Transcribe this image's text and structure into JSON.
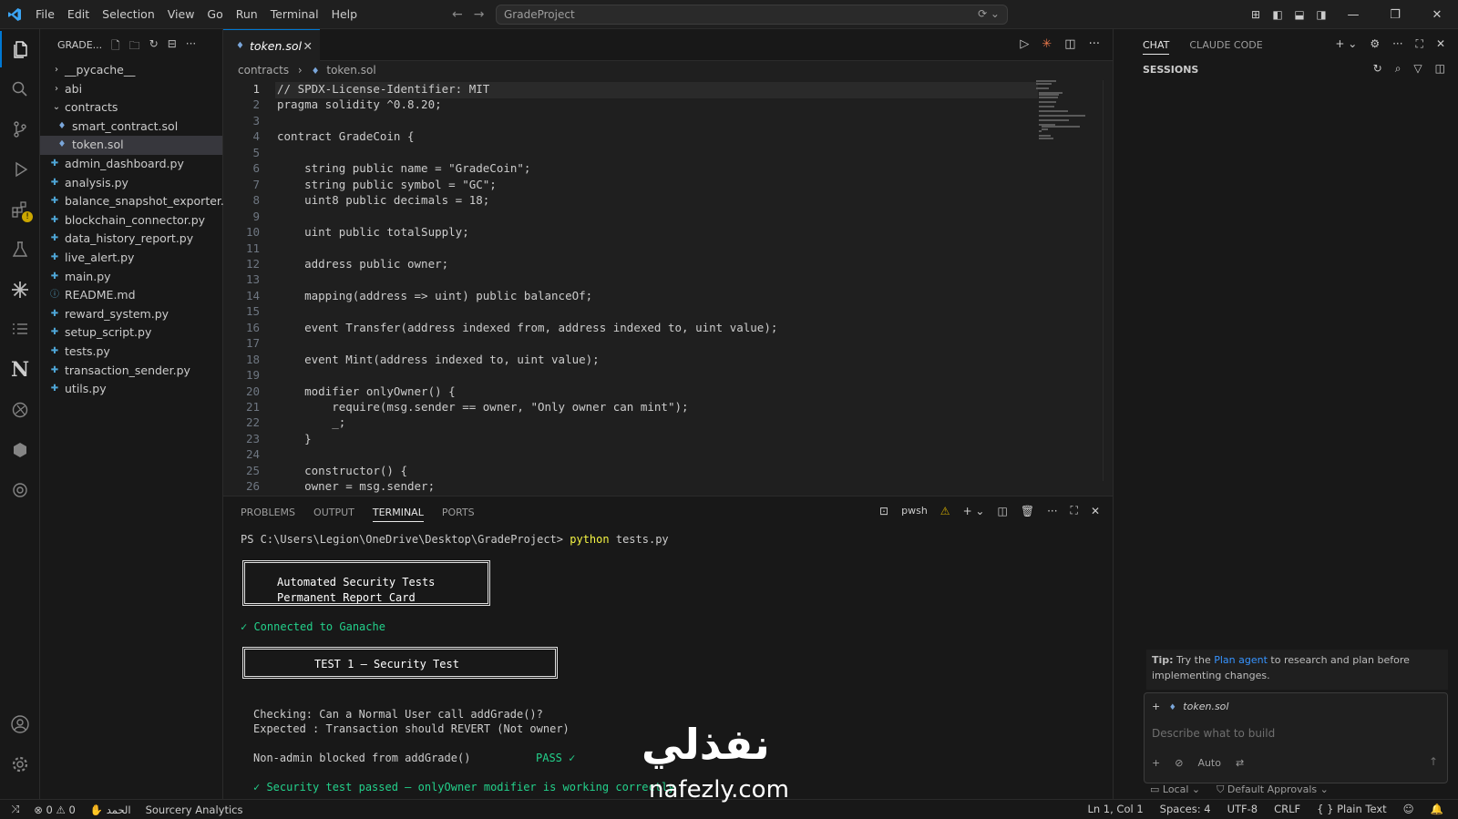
{
  "menu": [
    "File",
    "Edit",
    "Selection",
    "View",
    "Go",
    "Run",
    "Terminal",
    "Help"
  ],
  "command_center": "GradeProject",
  "explorer": {
    "title": "GRADE...",
    "items": [
      {
        "label": "__pycache__",
        "type": "folder",
        "depth": 0,
        "expanded": false
      },
      {
        "label": "abi",
        "type": "folder",
        "depth": 0,
        "expanded": false
      },
      {
        "label": "contracts",
        "type": "folder",
        "depth": 0,
        "expanded": true
      },
      {
        "label": "smart_contract.sol",
        "type": "sol",
        "depth": 1
      },
      {
        "label": "token.sol",
        "type": "sol",
        "depth": 1,
        "selected": true
      },
      {
        "label": "admin_dashboard.py",
        "type": "py",
        "depth": 0
      },
      {
        "label": "analysis.py",
        "type": "py",
        "depth": 0
      },
      {
        "label": "balance_snapshot_exporter.py",
        "type": "py",
        "depth": 0
      },
      {
        "label": "blockchain_connector.py",
        "type": "py",
        "depth": 0
      },
      {
        "label": "data_history_report.py",
        "type": "py",
        "depth": 0
      },
      {
        "label": "live_alert.py",
        "type": "py",
        "depth": 0
      },
      {
        "label": "main.py",
        "type": "py",
        "depth": 0
      },
      {
        "label": "README.md",
        "type": "md",
        "depth": 0
      },
      {
        "label": "reward_system.py",
        "type": "py",
        "depth": 0
      },
      {
        "label": "setup_script.py",
        "type": "py",
        "depth": 0
      },
      {
        "label": "tests.py",
        "type": "py",
        "depth": 0
      },
      {
        "label": "transaction_sender.py",
        "type": "py",
        "depth": 0
      },
      {
        "label": "utils.py",
        "type": "py",
        "depth": 0
      }
    ]
  },
  "editor": {
    "tab": "token.sol",
    "breadcrumb": [
      "contracts",
      "token.sol"
    ],
    "lines": [
      "// SPDX-License-Identifier: MIT",
      "pragma solidity ^0.8.20;",
      "",
      "contract GradeCoin {",
      "",
      "    string public name = \"GradeCoin\";",
      "    string public symbol = \"GC\";",
      "    uint8 public decimals = 18;",
      "",
      "    uint public totalSupply;",
      "",
      "    address public owner;",
      "",
      "    mapping(address => uint) public balanceOf;",
      "",
      "    event Transfer(address indexed from, address indexed to, uint value);",
      "",
      "    event Mint(address indexed to, uint value);",
      "",
      "    modifier onlyOwner() {",
      "        require(msg.sender == owner, \"Only owner can mint\");",
      "        _;",
      "    }",
      "",
      "    constructor() {",
      "    owner = msg.sender;"
    ]
  },
  "panel": {
    "tabs": [
      "PROBLEMS",
      "OUTPUT",
      "TERMINAL",
      "PORTS"
    ],
    "active_tab": "TERMINAL",
    "shell": "pwsh",
    "prompt": "PS C:\\Users\\Legion\\OneDrive\\Desktop\\GradeProject>",
    "command_exe": "python",
    "command_arg": "tests.py",
    "box1_line1": "Automated Security Tests",
    "box1_line2": "Permanent Report Card",
    "connected": "✓ Connected to Ganache",
    "box2": "TEST 1 — Security Test",
    "checking": "Checking: Can a Normal User call addGrade()?",
    "expected": "Expected : Transaction should REVERT (Not owner)",
    "result_label": "Non-admin blocked from addGrade()",
    "result_value": "PASS ✓",
    "passed": "✓ Security test passed — onlyOwner modifier is working correctly"
  },
  "chat": {
    "tabs": [
      "CHAT",
      "CLAUDE CODE"
    ],
    "active_tab": "CHAT",
    "sessions_label": "SESSIONS",
    "tip_prefix": "Tip:",
    "tip_pre": " Try the ",
    "tip_link": "Plan agent",
    "tip_post": " to research and plan before implementing changes.",
    "context_file": "token.sol",
    "input_placeholder": "Describe what to build",
    "mode": "Auto",
    "location": "Local",
    "approvals": "Default Approvals"
  },
  "statusbar": {
    "errors": "0",
    "warnings": "0",
    "language_pack": "الحمد",
    "extension": "Sourcery Analytics",
    "cursor": "Ln 1, Col 1",
    "spaces": "Spaces: 4",
    "encoding": "UTF-8",
    "eol": "CRLF",
    "language": "Plain Text"
  },
  "watermark": {
    "arabic": "نفذلي",
    "latin": "nafezly.com"
  },
  "colors": {
    "accent": "#0078d4",
    "terminal_green": "#23d18b",
    "terminal_yellow": "#f5f543",
    "link": "#3794ff"
  }
}
